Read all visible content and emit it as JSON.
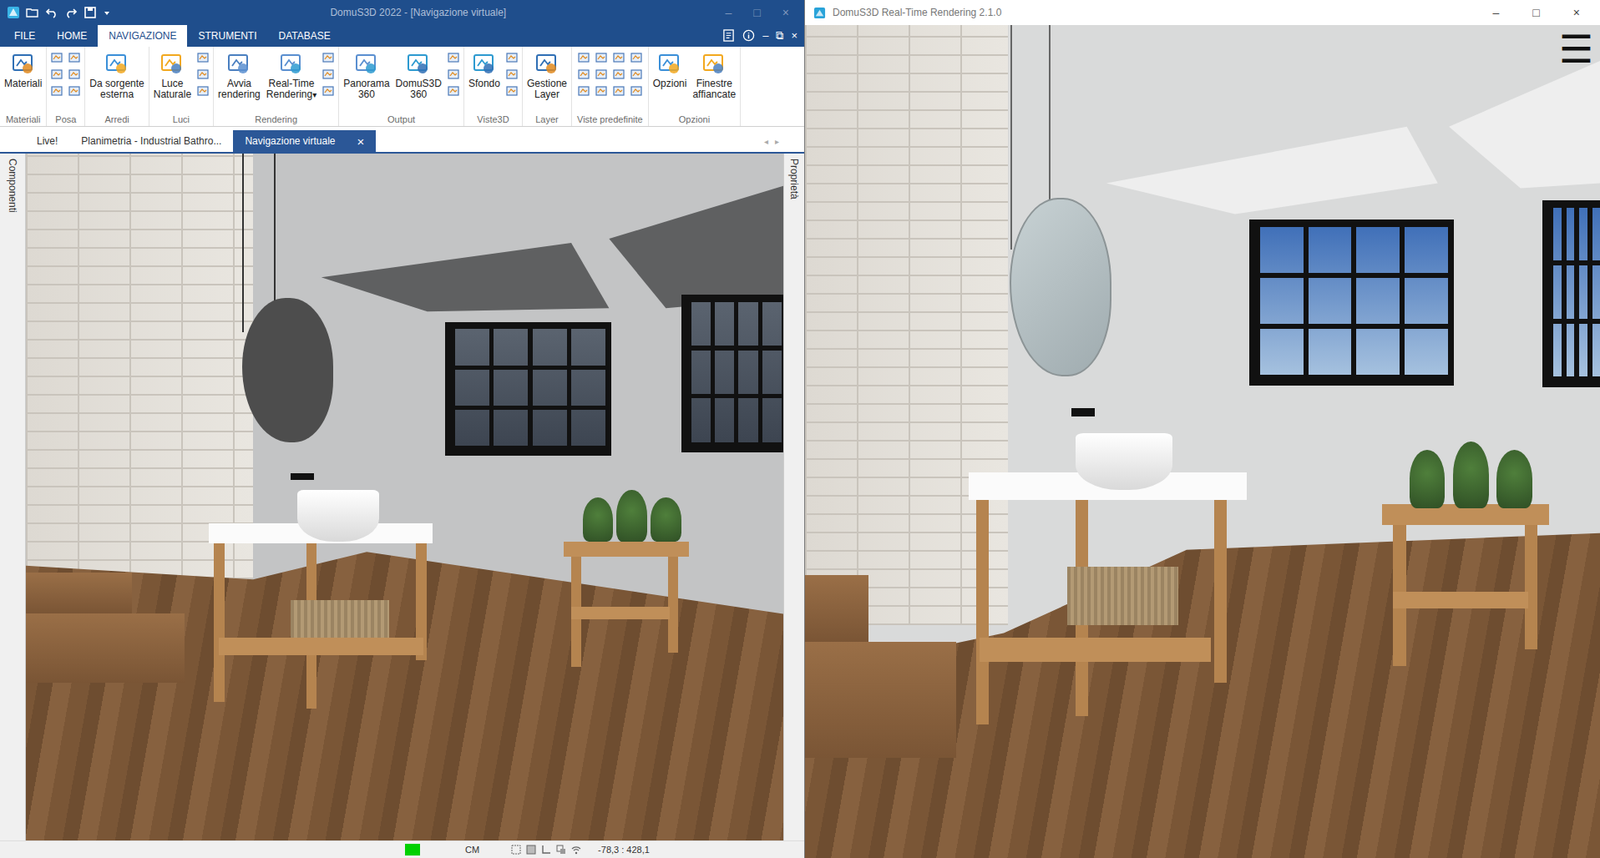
{
  "left_window": {
    "title": "DomuS3D 2022 - [Navigazione virtuale]",
    "window_controls": [
      "–",
      "□",
      "×"
    ],
    "menu_tabs": [
      {
        "label": "FILE",
        "selected": false
      },
      {
        "label": "HOME",
        "selected": false
      },
      {
        "label": "NAVIGAZIONE",
        "selected": true
      },
      {
        "label": "STRUMENTI",
        "selected": false
      },
      {
        "label": "DATABASE",
        "selected": false
      }
    ],
    "menu_controls": [
      "–",
      "⧉",
      "×"
    ],
    "ribbon_groups": [
      {
        "name": "Materiali",
        "buttons": [
          {
            "lines": [
              "Materiali"
            ]
          }
        ]
      },
      {
        "name": "Posa",
        "buttons": []
      },
      {
        "name": "Arredi",
        "buttons": [
          {
            "lines": [
              "Da sorgente",
              "esterna"
            ]
          }
        ]
      },
      {
        "name": "Luci",
        "buttons": [
          {
            "lines": [
              "Luce",
              "Naturale"
            ]
          }
        ]
      },
      {
        "name": "Rendering",
        "buttons": [
          {
            "lines": [
              "Avvia",
              "rendering"
            ]
          },
          {
            "lines": [
              "Real-Time",
              "Rendering"
            ],
            "dropdown": "▾"
          }
        ]
      },
      {
        "name": "Output",
        "buttons": [
          {
            "lines": [
              "Panorama",
              "360"
            ]
          },
          {
            "lines": [
              "DomuS3D",
              "360"
            ]
          }
        ]
      },
      {
        "name": "Viste3D",
        "buttons": [
          {
            "lines": [
              "Sfondo"
            ]
          }
        ]
      },
      {
        "name": "Layer",
        "buttons": [
          {
            "lines": [
              "Gestione",
              "Layer"
            ]
          }
        ]
      },
      {
        "name": "Viste predefinite",
        "buttons": []
      },
      {
        "name": "Opzioni",
        "buttons": [
          {
            "lines": [
              "Opzioni"
            ]
          },
          {
            "lines": [
              "Finestre",
              "affiancate"
            ]
          }
        ]
      }
    ],
    "doc_tabs": [
      {
        "label": "Live!",
        "selected": false
      },
      {
        "label": "Planimetria - Industrial Bathro...",
        "selected": false
      },
      {
        "label": "Navigazione virtuale",
        "selected": true,
        "close": "×"
      }
    ],
    "doc_nav": [
      "◂",
      "▸"
    ],
    "left_panel": "Componenti",
    "right_panel": "Proprietà",
    "status_bar": {
      "ok": true,
      "unit": "CM",
      "coords": "-78,3 : 428,1"
    }
  },
  "right_window": {
    "title": "DomuS3D Real-Time Rendering 2.1.0",
    "window_controls": [
      "–",
      "□",
      "×"
    ],
    "menu_icon": "☰"
  }
}
